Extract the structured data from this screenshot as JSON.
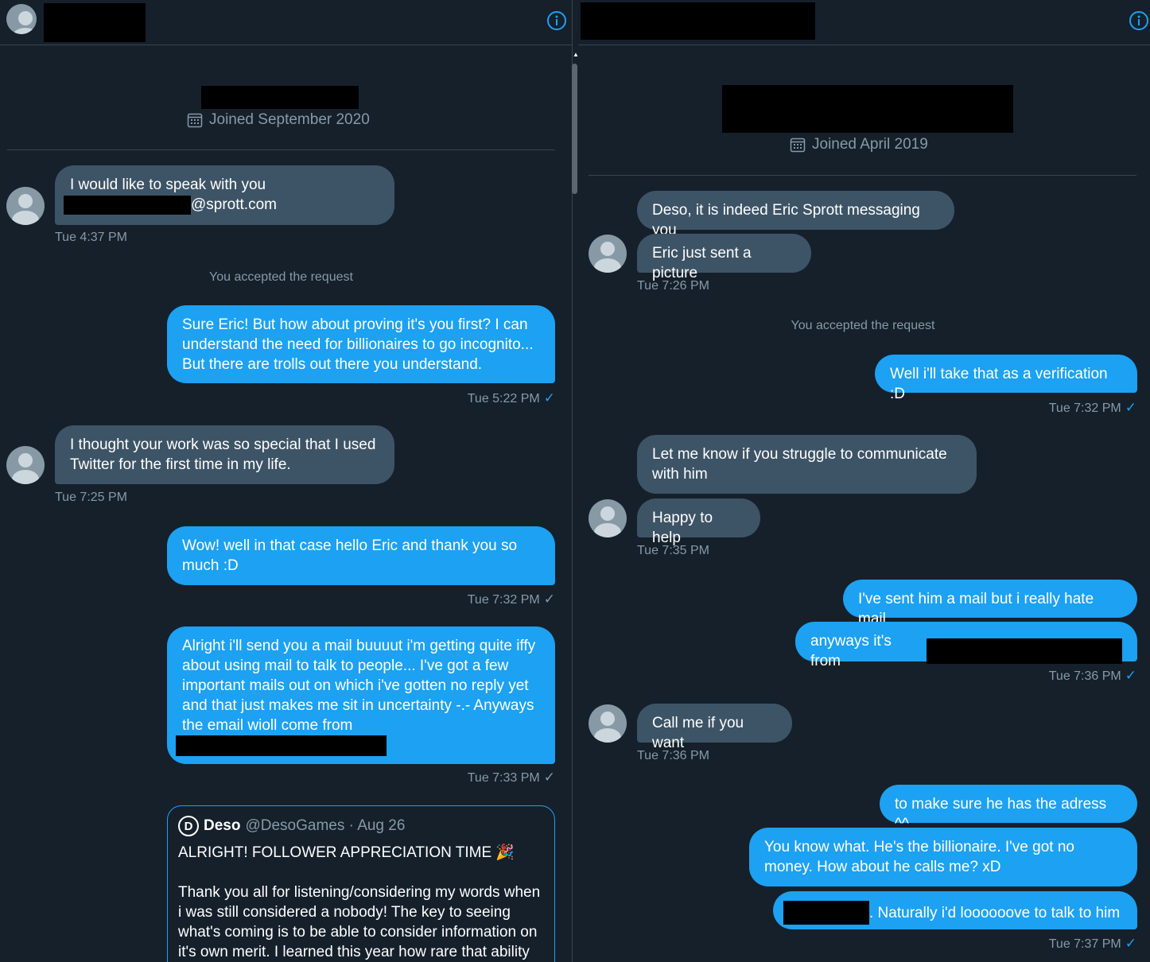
{
  "left": {
    "joined": "Joined September 2020",
    "messages": [
      {
        "type": "in",
        "lines": [
          "I would like to speak with you"
        ],
        "email_suffix": "@sprott.com",
        "time": "Tue 4:37 PM"
      },
      {
        "type": "system",
        "text": "You accepted the request"
      },
      {
        "type": "out",
        "text": "Sure Eric! But how about proving it's you first? I can understand the need for billionaires to go incognito... But there are trolls out there you understand.",
        "time": "Tue 5:22 PM"
      },
      {
        "type": "in",
        "text": "I thought your work was so special that I used Twitter for the first time in my life.",
        "time": "Tue 7:25 PM"
      },
      {
        "type": "out",
        "text": "Wow! well in that case hello Eric and thank you so much :D",
        "time": "Tue 7:32 PM"
      },
      {
        "type": "out",
        "text": "Alright i'll send you a mail buuuut i'm getting quite iffy about using mail to talk to people... I've got a few important mails out on which i've gotten no reply yet and that just makes me sit in uncertainty -.- Anyways the email wioll come from",
        "time": "Tue 7:33 PM"
      }
    ],
    "quote": {
      "logo": "D",
      "name": "Deso",
      "handle": "@DesoGames · Aug 26",
      "title": "ALRIGHT! FOLLOWER APPRECIATION TIME 🎉",
      "body": "Thank you all for listening/considering my words when i was still considered a nobody! The key to seeing what's coming is to be able to consider information on it's own merit. I learned this year how rare that ability is"
    }
  },
  "right": {
    "joined": "Joined April 2019",
    "m1": "Deso, it is indeed Eric Sprott messaging you",
    "m2": "Eric just sent a picture",
    "t1": "Tue 7:26 PM",
    "system": "You accepted the request",
    "m3": "Well i'll take that as a verification :D",
    "t2": "Tue 7:32 PM",
    "m4": "Let me know if you struggle to communicate with him",
    "m5": "Happy to help",
    "t3": "Tue 7:35 PM",
    "m6": "I've sent him a mail but i really hate mail",
    "m7": "anyways it's from",
    "t4": "Tue 7:36 PM",
    "m8": "Call me if you want",
    "t5": "Tue 7:36 PM",
    "m9": "to make sure he has the adress ^^",
    "m10": "You know what. He's the billionaire. I've got no money. How about he calls me? xD",
    "m11": ". Naturally i'd loooooove to talk to him",
    "t6": "Tue 7:37 PM"
  },
  "check": "✓",
  "colors": {
    "background": "#15202b",
    "incoming": "#3d5466",
    "outgoing": "#1da1f2",
    "muted": "#8899a6"
  }
}
